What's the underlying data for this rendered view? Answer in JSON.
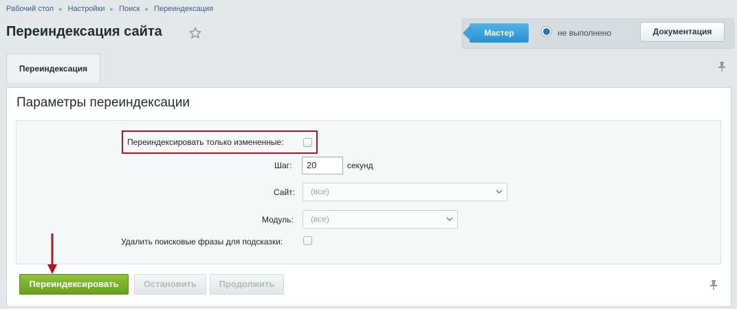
{
  "breadcrumb": {
    "items": [
      "Рабочий стол",
      "Настройки",
      "Поиск",
      "Переиндексация"
    ]
  },
  "header": {
    "title": "Переиндексация сайта",
    "star_icon": "star-icon"
  },
  "admin_panel": {
    "master_label": "Мастер",
    "status_text": "не выполнено",
    "docs_label": "Документация"
  },
  "tabs": [
    {
      "label": "Переиндексация",
      "active": true
    }
  ],
  "card": {
    "title": "Параметры переиндексации"
  },
  "form": {
    "only_changed_label": "Переиндексировать только измененные:",
    "only_changed_checked": false,
    "step_label": "Шаг:",
    "step_value": "20",
    "step_unit": "секунд",
    "site_label": "Сайт:",
    "site_value": "(все)",
    "module_label": "Модуль:",
    "module_value": "(все)",
    "delete_phrases_label": "Удалить поисковые фразы для подсказки:",
    "delete_phrases_checked": false
  },
  "buttons": {
    "reindex": "Переиндексировать",
    "stop": "Остановить",
    "continue": "Продолжить"
  },
  "colors": {
    "accent_blue": "#2a8fd0",
    "primary_green": "#65a01c",
    "highlight_red": "#b3121e"
  }
}
